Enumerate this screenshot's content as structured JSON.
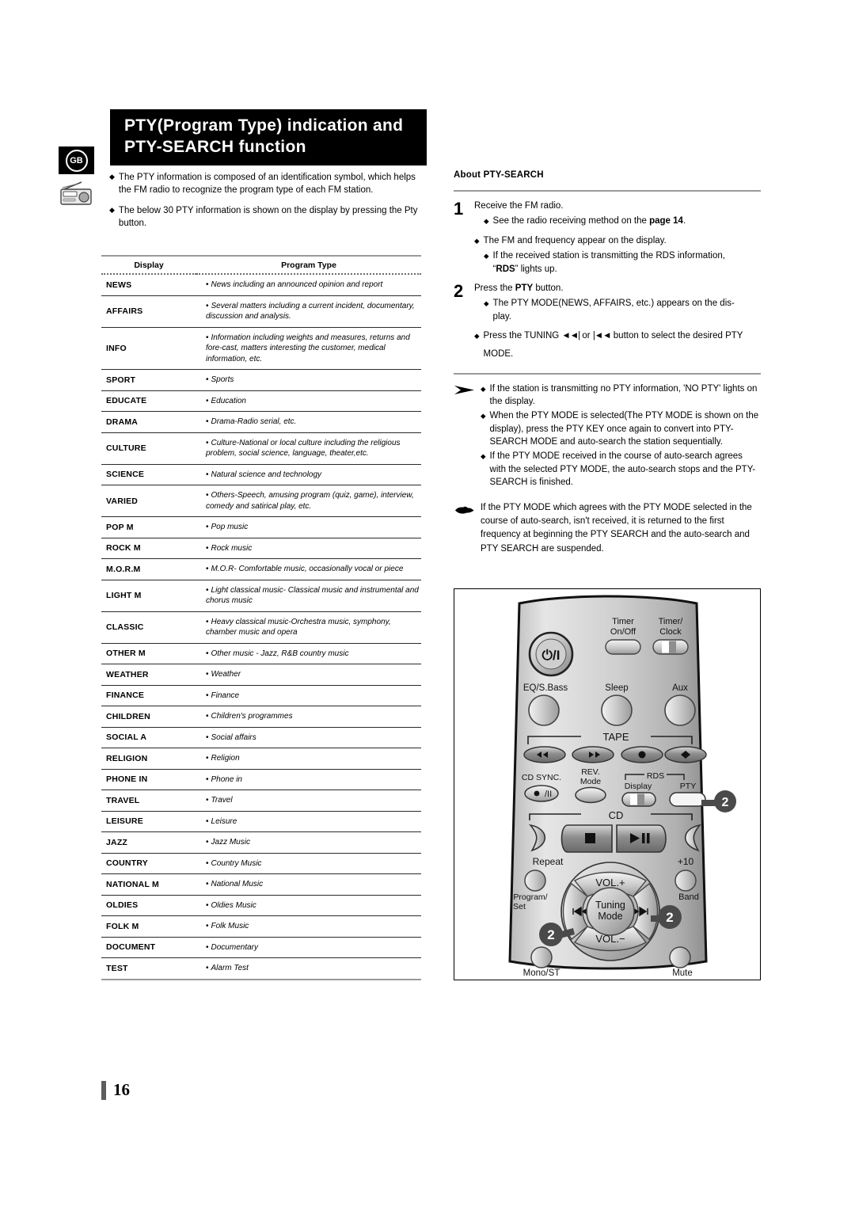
{
  "page": {
    "number": "16",
    "locale_badge": "GB"
  },
  "header": {
    "title_line1": "PTY(Program Type) indication and",
    "title_line2": "PTY-SEARCH function"
  },
  "intro": {
    "bullets": [
      "The PTY information is composed of an identification symbol, which helps the FM radio to recognize the program type of each FM station.",
      "The below 30 PTY information is shown on the display by pressing the Pty button."
    ]
  },
  "pty_table": {
    "columns": [
      "Display",
      "Program Type"
    ],
    "rows": [
      {
        "display": "NEWS",
        "type": "News including an announced opinion and report"
      },
      {
        "display": "AFFAIRS",
        "type": "Several matters including a current incident, documentary, discussion and analysis."
      },
      {
        "display": "INFO",
        "type": "Information including weights and measures, returns and fore-cast, matters interesting the customer, medical information, etc."
      },
      {
        "display": "SPORT",
        "type": "Sports"
      },
      {
        "display": "EDUCATE",
        "type": "Education"
      },
      {
        "display": "DRAMA",
        "type": "Drama-Radio serial, etc."
      },
      {
        "display": "CULTURE",
        "type": "Culture-National or local culture including the religious problem, social science, language, theater,etc."
      },
      {
        "display": "SCIENCE",
        "type": "Natural science and technology"
      },
      {
        "display": "VARIED",
        "type": "Others-Speech, amusing program (quiz, game), interview, comedy and satirical play, etc."
      },
      {
        "display": "POP M",
        "type": "Pop music"
      },
      {
        "display": "ROCK M",
        "type": "Rock music"
      },
      {
        "display": "M.O.R.M",
        "type": "M.O.R- Comfortable music, occasionally vocal or piece"
      },
      {
        "display": "LIGHT M",
        "type": "Light classical music- Classical music and instrumental and chorus music"
      },
      {
        "display": "CLASSIC",
        "type": "Heavy classical  music-Orchestra music, symphony, chamber music and opera"
      },
      {
        "display": "OTHER M",
        "type": "Other music - Jazz, R&B country music"
      },
      {
        "display": "WEATHER",
        "type": "Weather"
      },
      {
        "display": "FINANCE",
        "type": "Finance"
      },
      {
        "display": "CHILDREN",
        "type": "Children's programmes"
      },
      {
        "display": "SOCIAL  A",
        "type": "Social affairs"
      },
      {
        "display": "RELIGION",
        "type": "Religion"
      },
      {
        "display": "PHONE IN",
        "type": "Phone in"
      },
      {
        "display": "TRAVEL",
        "type": "Travel"
      },
      {
        "display": "LEISURE",
        "type": "Leisure"
      },
      {
        "display": "JAZZ",
        "type": "Jazz Music"
      },
      {
        "display": "COUNTRY",
        "type": "Country Music"
      },
      {
        "display": "NATIONAL M",
        "type": "National Music"
      },
      {
        "display": "OLDIES",
        "type": "Oldies Music"
      },
      {
        "display": "FOLK M",
        "type": "Folk Music"
      },
      {
        "display": "DOCUMENT",
        "type": "Documentary"
      },
      {
        "display": "TEST",
        "type": "Alarm Test"
      }
    ]
  },
  "about": {
    "title": "About PTY-SEARCH",
    "step1": {
      "num": "1",
      "lead": "Receive the FM radio.",
      "sub_a": "See the radio receiving method on the page 14.",
      "sub_b": "The FM and frequency appear on the display.",
      "sub_c": "If the received station is transmitting the RDS information, “RDS” lights up."
    },
    "step2": {
      "num": "2",
      "lead": "Press the PTY button.",
      "sub_a": "The PTY MODE(NEWS, AFFAIRS, etc.) appears on the dis-play.",
      "sub_b_pre": "Press the TUNING",
      "sub_b_mid": "or",
      "sub_b_post": "button to select the desired PTY",
      "sub_b_tail": "MODE."
    },
    "notes": [
      "If the station is transmitting no PTY information, 'NO PTY' lights on the display.",
      "When the PTY MODE is selected(The PTY MODE is shown on the display), press the PTY KEY once again to convert into PTY-SEARCH MODE and auto-search the station sequentially.",
      "If the PTY MODE received in the course of auto-search agrees with the selected PTY MODE, the auto-search stops and the PTY-SEARCH is finished."
    ],
    "hand_note": "If the PTY MODE which agrees with the PTY MODE selected in the course of auto-search, isn't received, it is returned to the first frequency at beginning the PTY SEARCH and the auto-search and PTY SEARCH are suspended."
  },
  "remote": {
    "labels": {
      "timer_on_off": "Timer\nOn/Off",
      "timer_on_off_l1": "Timer",
      "timer_on_off_l2": "On/Off",
      "timer_clock_l1": "Timer/",
      "timer_clock_l2": "Clock",
      "eq_sbass": "EQ/S.Bass",
      "sleep": "Sleep",
      "aux": "Aux",
      "tape": "TAPE",
      "cd_sync": "CD SYNC.",
      "rev_l1": "REV.",
      "rev_l2": "Mode",
      "display": "Display",
      "rds": "RDS",
      "pty": "PTY",
      "cd": "CD",
      "repeat": "Repeat",
      "plus_ten": "+10",
      "program_l1": "Program/",
      "program_l2": "Set",
      "band": "Band",
      "vol_plus": "VOL.+",
      "vol_minus": "VOL.−",
      "tuning_l1": "Tuning",
      "tuning_l2": "Mode",
      "mono_st": "Mono/ST",
      "mute": "Mute",
      "power": "⏻/I"
    },
    "callouts": [
      "2",
      "2",
      "2"
    ]
  },
  "colors": {
    "header_bg": "#000000",
    "rule_gray": "#9a9a9a",
    "callout_gray": "#4a4a4a",
    "body_silver": "#c8c8c8"
  }
}
